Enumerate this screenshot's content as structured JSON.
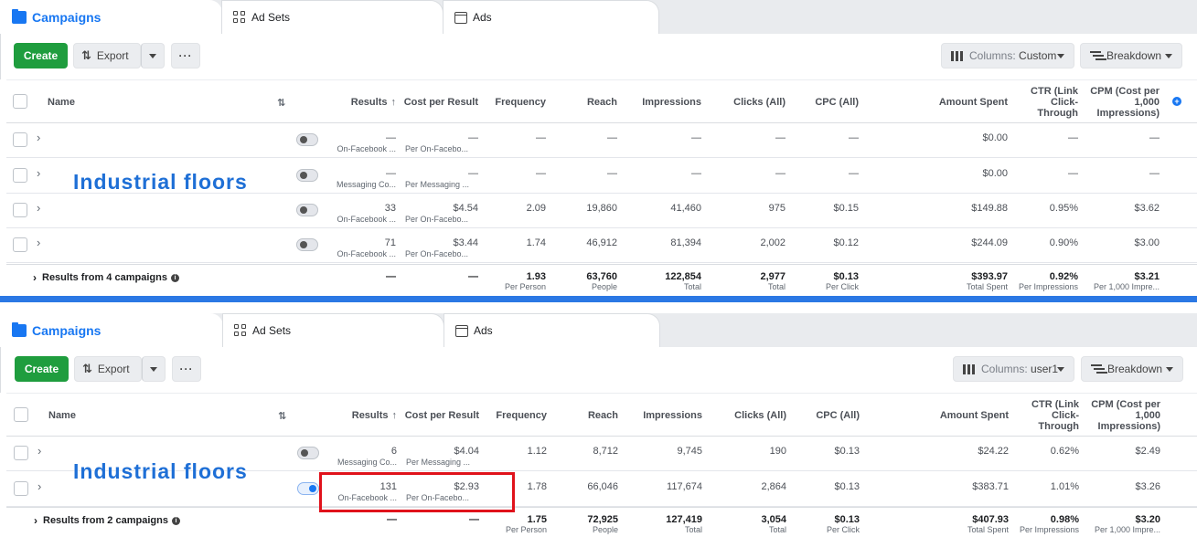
{
  "top": {
    "tabs": {
      "campaigns": "Campaigns",
      "adsets": "Ad Sets",
      "ads": "Ads"
    },
    "toolbar": {
      "create": "Create",
      "export": "Export",
      "more": "···",
      "columns_prefix": "Columns:",
      "columns_value": "Custom",
      "breakdown": "Breakdown"
    },
    "headers": {
      "name": "Name",
      "results": "Results",
      "cost": "Cost per Result",
      "frequency": "Frequency",
      "reach": "Reach",
      "impressions": "Impressions",
      "clicks": "Clicks (All)",
      "cpc": "CPC (All)",
      "amount": "Amount Spent",
      "ctr": "CTR (Link Click-Through",
      "cpm": "CPM (Cost per 1,000 Impressions)"
    },
    "overlay_text": "Industrial floors",
    "rows": [
      {
        "results": "—",
        "results_sub": "On-Facebook ...",
        "cost": "—",
        "cost_sub": "Per On-Facebo...",
        "frequency": "—",
        "reach": "—",
        "impressions": "—",
        "clicks": "—",
        "cpc": "—",
        "amount": "$0.00",
        "ctr": "—",
        "cpm": "—"
      },
      {
        "results": "—",
        "results_sub": "Messaging Co...",
        "cost": "—",
        "cost_sub": "Per Messaging ...",
        "frequency": "—",
        "reach": "—",
        "impressions": "—",
        "clicks": "—",
        "cpc": "—",
        "amount": "$0.00",
        "ctr": "—",
        "cpm": "—"
      },
      {
        "results": "33",
        "results_sub": "On-Facebook ...",
        "cost": "$4.54",
        "cost_sub": "Per On-Facebo...",
        "frequency": "2.09",
        "reach": "19,860",
        "impressions": "41,460",
        "clicks": "975",
        "cpc": "$0.15",
        "amount": "$149.88",
        "ctr": "0.95%",
        "cpm": "$3.62"
      },
      {
        "results": "71",
        "results_sub": "On-Facebook ...",
        "cost": "$3.44",
        "cost_sub": "Per On-Facebo...",
        "frequency": "1.74",
        "reach": "46,912",
        "impressions": "81,394",
        "clicks": "2,002",
        "cpc": "$0.12",
        "amount": "$244.09",
        "ctr": "0.90%",
        "cpm": "$3.00"
      }
    ],
    "summary": {
      "label": "Results from 4 campaigns",
      "results": "—",
      "cost": "—",
      "frequency": "1.93",
      "frequency_sub": "Per Person",
      "reach": "63,760",
      "reach_sub": "People",
      "impressions": "122,854",
      "impressions_sub": "Total",
      "clicks": "2,977",
      "clicks_sub": "Total",
      "cpc": "$0.13",
      "cpc_sub": "Per Click",
      "amount": "$393.97",
      "amount_sub": "Total Spent",
      "ctr": "0.92%",
      "ctr_sub": "Per Impressions",
      "cpm": "$3.21",
      "cpm_sub": "Per 1,000 Impre..."
    }
  },
  "bottom": {
    "tabs": {
      "campaigns": "Campaigns",
      "adsets": "Ad Sets",
      "ads": "Ads"
    },
    "toolbar": {
      "create": "Create",
      "export": "Export",
      "more": "···",
      "columns_prefix": "Columns:",
      "columns_value": "user1",
      "breakdown": "Breakdown"
    },
    "headers": {
      "name": "Name",
      "results": "Results",
      "cost": "Cost per Result",
      "frequency": "Frequency",
      "reach": "Reach",
      "impressions": "Impressions",
      "clicks": "Clicks (All)",
      "cpc": "CPC (All)",
      "amount": "Amount Spent",
      "ctr": "CTR (Link Click-Through",
      "cpm": "CPM (Cost per 1,000 Impressions)"
    },
    "overlay_text": "Industrial floors",
    "rows": [
      {
        "results": "6",
        "results_sub": "Messaging Co...",
        "cost": "$4.04",
        "cost_sub": "Per Messaging ...",
        "frequency": "1.12",
        "reach": "8,712",
        "impressions": "9,745",
        "clicks": "190",
        "cpc": "$0.13",
        "amount": "$24.22",
        "ctr": "0.62%",
        "cpm": "$2.49"
      },
      {
        "results": "131",
        "results_sub": "On-Facebook ...",
        "cost": "$2.93",
        "cost_sub": "Per On-Facebo...",
        "frequency": "1.78",
        "reach": "66,046",
        "impressions": "117,674",
        "clicks": "2,864",
        "cpc": "$0.13",
        "amount": "$383.71",
        "ctr": "1.01%",
        "cpm": "$3.26"
      }
    ],
    "summary": {
      "label": "Results from 2 campaigns",
      "results": "—",
      "cost": "—",
      "frequency": "1.75",
      "frequency_sub": "Per Person",
      "reach": "72,925",
      "reach_sub": "People",
      "impressions": "127,419",
      "impressions_sub": "Total",
      "clicks": "3,054",
      "clicks_sub": "Total",
      "cpc": "$0.13",
      "cpc_sub": "Per Click",
      "amount": "$407.93",
      "amount_sub": "Total Spent",
      "ctr": "0.98%",
      "ctr_sub": "Per Impressions",
      "cpm": "$3.20",
      "cpm_sub": "Per 1,000 Impre..."
    }
  },
  "colors": {
    "accent": "#1877f2",
    "create": "#1f9d3e",
    "divider": "#2b78e4",
    "highlight": "#e0121b"
  }
}
